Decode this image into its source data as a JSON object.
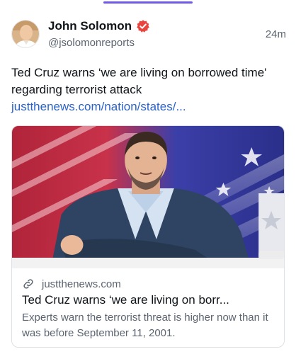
{
  "post": {
    "author": {
      "display_name": "John Solomon",
      "handle": "@jsolomonreports",
      "verified": true,
      "avatar_icon": "profile-photo"
    },
    "timestamp": "24m",
    "text": "Ted Cruz warns ‘we are living on borrowed time' regarding terrorist attack",
    "link_text": "justthenews.com/nation/states/..."
  },
  "card": {
    "image_icon": "ted-cruz-photo",
    "domain": "justthenews.com",
    "title": "Ted Cruz warns ‘we are living on borr...",
    "description": "Experts warn the terrorist threat is higher now than it was before September 11, 2001."
  },
  "colors": {
    "accent": "#6f5ae8",
    "link": "#2b63c9",
    "verified_badge": "#e8433d",
    "muted_text": "#5b6470"
  }
}
